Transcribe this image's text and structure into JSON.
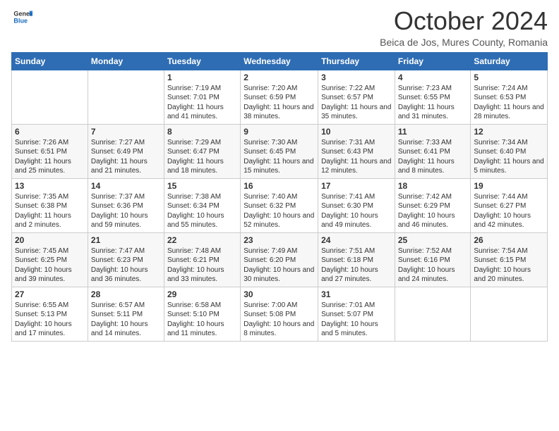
{
  "header": {
    "logo_general": "General",
    "logo_blue": "Blue",
    "month": "October 2024",
    "location": "Beica de Jos, Mures County, Romania"
  },
  "days_of_week": [
    "Sunday",
    "Monday",
    "Tuesday",
    "Wednesday",
    "Thursday",
    "Friday",
    "Saturday"
  ],
  "weeks": [
    [
      {
        "day": "",
        "info": ""
      },
      {
        "day": "",
        "info": ""
      },
      {
        "day": "1",
        "info": "Sunrise: 7:19 AM\nSunset: 7:01 PM\nDaylight: 11 hours and 41 minutes."
      },
      {
        "day": "2",
        "info": "Sunrise: 7:20 AM\nSunset: 6:59 PM\nDaylight: 11 hours and 38 minutes."
      },
      {
        "day": "3",
        "info": "Sunrise: 7:22 AM\nSunset: 6:57 PM\nDaylight: 11 hours and 35 minutes."
      },
      {
        "day": "4",
        "info": "Sunrise: 7:23 AM\nSunset: 6:55 PM\nDaylight: 11 hours and 31 minutes."
      },
      {
        "day": "5",
        "info": "Sunrise: 7:24 AM\nSunset: 6:53 PM\nDaylight: 11 hours and 28 minutes."
      }
    ],
    [
      {
        "day": "6",
        "info": "Sunrise: 7:26 AM\nSunset: 6:51 PM\nDaylight: 11 hours and 25 minutes."
      },
      {
        "day": "7",
        "info": "Sunrise: 7:27 AM\nSunset: 6:49 PM\nDaylight: 11 hours and 21 minutes."
      },
      {
        "day": "8",
        "info": "Sunrise: 7:29 AM\nSunset: 6:47 PM\nDaylight: 11 hours and 18 minutes."
      },
      {
        "day": "9",
        "info": "Sunrise: 7:30 AM\nSunset: 6:45 PM\nDaylight: 11 hours and 15 minutes."
      },
      {
        "day": "10",
        "info": "Sunrise: 7:31 AM\nSunset: 6:43 PM\nDaylight: 11 hours and 12 minutes."
      },
      {
        "day": "11",
        "info": "Sunrise: 7:33 AM\nSunset: 6:41 PM\nDaylight: 11 hours and 8 minutes."
      },
      {
        "day": "12",
        "info": "Sunrise: 7:34 AM\nSunset: 6:40 PM\nDaylight: 11 hours and 5 minutes."
      }
    ],
    [
      {
        "day": "13",
        "info": "Sunrise: 7:35 AM\nSunset: 6:38 PM\nDaylight: 11 hours and 2 minutes."
      },
      {
        "day": "14",
        "info": "Sunrise: 7:37 AM\nSunset: 6:36 PM\nDaylight: 10 hours and 59 minutes."
      },
      {
        "day": "15",
        "info": "Sunrise: 7:38 AM\nSunset: 6:34 PM\nDaylight: 10 hours and 55 minutes."
      },
      {
        "day": "16",
        "info": "Sunrise: 7:40 AM\nSunset: 6:32 PM\nDaylight: 10 hours and 52 minutes."
      },
      {
        "day": "17",
        "info": "Sunrise: 7:41 AM\nSunset: 6:30 PM\nDaylight: 10 hours and 49 minutes."
      },
      {
        "day": "18",
        "info": "Sunrise: 7:42 AM\nSunset: 6:29 PM\nDaylight: 10 hours and 46 minutes."
      },
      {
        "day": "19",
        "info": "Sunrise: 7:44 AM\nSunset: 6:27 PM\nDaylight: 10 hours and 42 minutes."
      }
    ],
    [
      {
        "day": "20",
        "info": "Sunrise: 7:45 AM\nSunset: 6:25 PM\nDaylight: 10 hours and 39 minutes."
      },
      {
        "day": "21",
        "info": "Sunrise: 7:47 AM\nSunset: 6:23 PM\nDaylight: 10 hours and 36 minutes."
      },
      {
        "day": "22",
        "info": "Sunrise: 7:48 AM\nSunset: 6:21 PM\nDaylight: 10 hours and 33 minutes."
      },
      {
        "day": "23",
        "info": "Sunrise: 7:49 AM\nSunset: 6:20 PM\nDaylight: 10 hours and 30 minutes."
      },
      {
        "day": "24",
        "info": "Sunrise: 7:51 AM\nSunset: 6:18 PM\nDaylight: 10 hours and 27 minutes."
      },
      {
        "day": "25",
        "info": "Sunrise: 7:52 AM\nSunset: 6:16 PM\nDaylight: 10 hours and 24 minutes."
      },
      {
        "day": "26",
        "info": "Sunrise: 7:54 AM\nSunset: 6:15 PM\nDaylight: 10 hours and 20 minutes."
      }
    ],
    [
      {
        "day": "27",
        "info": "Sunrise: 6:55 AM\nSunset: 5:13 PM\nDaylight: 10 hours and 17 minutes."
      },
      {
        "day": "28",
        "info": "Sunrise: 6:57 AM\nSunset: 5:11 PM\nDaylight: 10 hours and 14 minutes."
      },
      {
        "day": "29",
        "info": "Sunrise: 6:58 AM\nSunset: 5:10 PM\nDaylight: 10 hours and 11 minutes."
      },
      {
        "day": "30",
        "info": "Sunrise: 7:00 AM\nSunset: 5:08 PM\nDaylight: 10 hours and 8 minutes."
      },
      {
        "day": "31",
        "info": "Sunrise: 7:01 AM\nSunset: 5:07 PM\nDaylight: 10 hours and 5 minutes."
      },
      {
        "day": "",
        "info": ""
      },
      {
        "day": "",
        "info": ""
      }
    ]
  ]
}
